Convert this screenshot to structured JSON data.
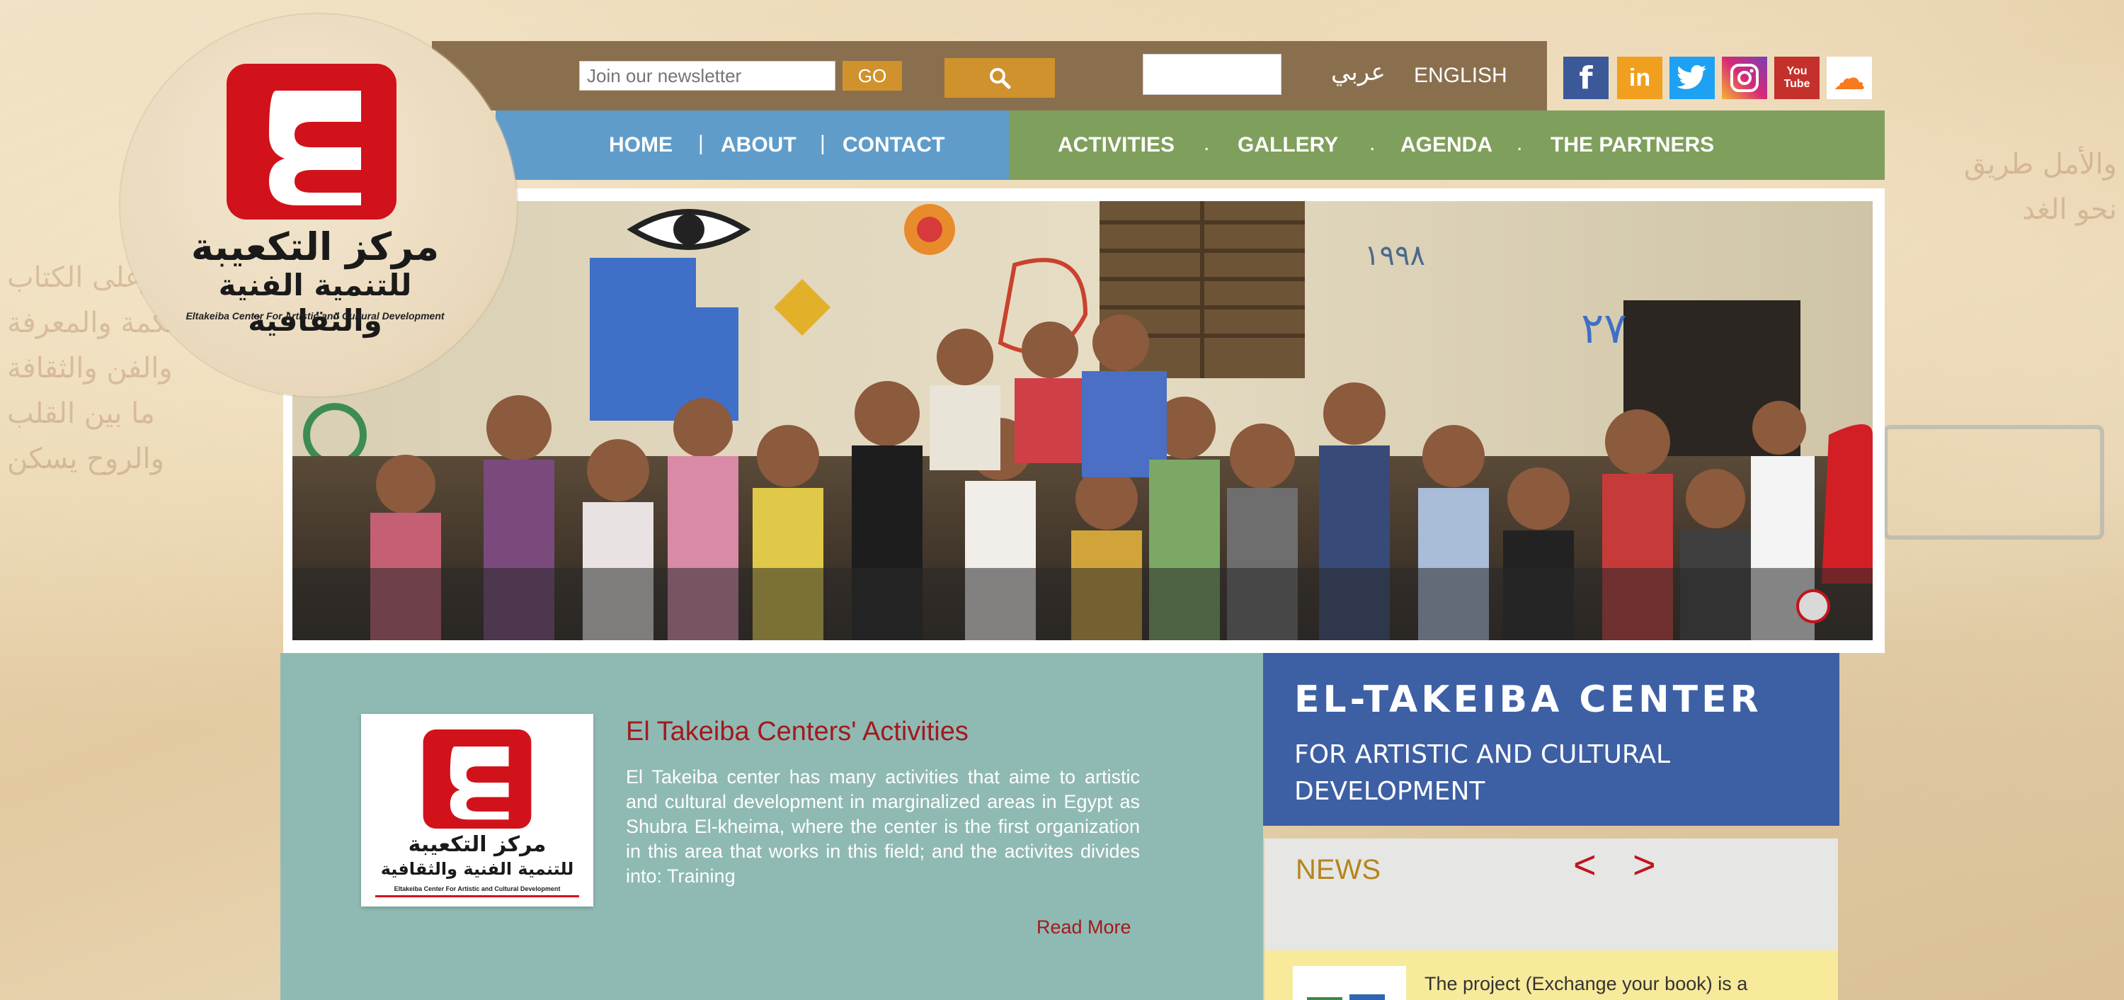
{
  "logo": {
    "letter": "ع",
    "arabic_name_line1": "مركز التكعيبة",
    "arabic_name_line2": "للتنمية الفنية والثقافية",
    "english_name": "Eltakeiba Center For Artistic and Cultural Development"
  },
  "topbar": {
    "newsletter_placeholder": "Join our newsletter",
    "go_label": "GO",
    "lang_arabic": "عربي",
    "lang_english": "ENGLISH"
  },
  "social": [
    {
      "name": "facebook",
      "glyph": "f",
      "color": "#3b5998"
    },
    {
      "name": "linkedin",
      "glyph": "in",
      "color": "#f0a01e"
    },
    {
      "name": "twitter",
      "glyph": "t",
      "color": "#1da1f2"
    },
    {
      "name": "instagram",
      "glyph": "◎",
      "color": "#b83b8f"
    },
    {
      "name": "youtube",
      "glyph": "You Tube",
      "color": "#c4302b"
    },
    {
      "name": "soundcloud",
      "glyph": "☁",
      "color": "#f77a1e"
    }
  ],
  "nav": {
    "home": "HOME",
    "about": "ABOUT",
    "contact": "CONTACT",
    "activities": "ACTIVITIES",
    "gallery": "GALLERY",
    "agenda": "AGENDA",
    "partners": "THE PARTNERS",
    "sep_bar": "|",
    "sep_dot": "."
  },
  "activities": {
    "title": "El Takeiba Centers' Activities",
    "text": "El Takeiba center has many activities that aime to artistic and cultural development in marginalized areas in Egypt as Shubra El-kheima, where the center is the first organization in this area that works in this field; and the activites divides into: Training",
    "read_more": "Read More"
  },
  "center": {
    "title": "EL-TAKEIBA CENTER",
    "subtitle": "FOR ARTISTIC AND CULTURAL DEVELOPMENT"
  },
  "news": {
    "title": "NEWS",
    "prev": "<",
    "next": ">",
    "item_text": "The project (Exchange your book) is a"
  },
  "colors": {
    "topbar": "#8a6f4e",
    "accent_orange": "#d0922c",
    "nav_blue": "#5f9cc9",
    "nav_green": "#7f9f5c",
    "main_teal": "#8fbab3",
    "center_blue": "#3d5fa4",
    "brand_red": "#c0141c"
  }
}
